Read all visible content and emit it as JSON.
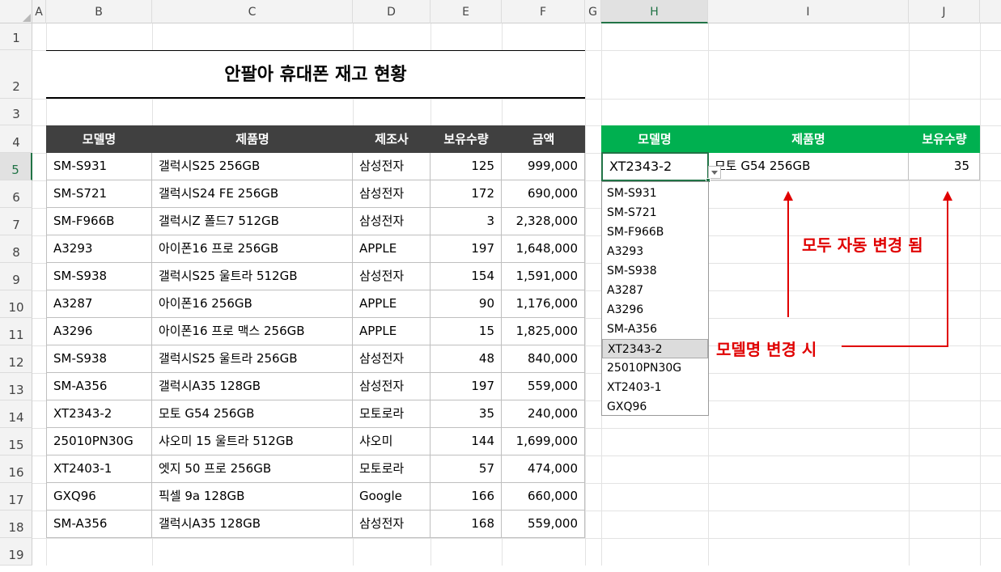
{
  "columns": [
    "A",
    "B",
    "C",
    "D",
    "E",
    "F",
    "G",
    "H",
    "I",
    "J"
  ],
  "rows": [
    "1",
    "2",
    "3",
    "4",
    "5",
    "6",
    "7",
    "8",
    "9",
    "10",
    "11",
    "12",
    "13",
    "14",
    "15",
    "16",
    "17",
    "18",
    "19"
  ],
  "title": "안팔아 휴대폰 재고 현황",
  "left_table": {
    "headers": [
      "모델명",
      "제품명",
      "제조사",
      "보유수량",
      "금액"
    ],
    "rows": [
      [
        "SM-S931",
        "갤럭시S25 256GB",
        "삼성전자",
        "125",
        "999,000"
      ],
      [
        "SM-S721",
        "갤럭시S24 FE 256GB",
        "삼성전자",
        "172",
        "690,000"
      ],
      [
        "SM-F966B",
        "갤럭시Z 폴드7 512GB",
        "삼성전자",
        "3",
        "2,328,000"
      ],
      [
        "A3293",
        "아이폰16 프로 256GB",
        "APPLE",
        "197",
        "1,648,000"
      ],
      [
        "SM-S938",
        "갤럭시S25 울트라 512GB",
        "삼성전자",
        "154",
        "1,591,000"
      ],
      [
        "A3287",
        "아이폰16 256GB",
        "APPLE",
        "90",
        "1,176,000"
      ],
      [
        "A3296",
        "아이폰16 프로 맥스 256GB",
        "APPLE",
        "15",
        "1,825,000"
      ],
      [
        "SM-S938",
        "갤럭시S25 울트라 256GB",
        "삼성전자",
        "48",
        "840,000"
      ],
      [
        "SM-A356",
        "갤럭시A35 128GB",
        "삼성전자",
        "197",
        "559,000"
      ],
      [
        "XT2343-2",
        "모토 G54 256GB",
        "모토로라",
        "35",
        "240,000"
      ],
      [
        "25010PN30G",
        "샤오미 15 울트라 512GB",
        "샤오미",
        "144",
        "1,699,000"
      ],
      [
        "XT2403-1",
        "엣지 50 프로 256GB",
        "모토로라",
        "57",
        "474,000"
      ],
      [
        "GXQ96",
        "픽셀 9a 128GB",
        "Google",
        "166",
        "660,000"
      ],
      [
        "SM-A356",
        "갤럭시A35 128GB",
        "삼성전자",
        "168",
        "559,000"
      ]
    ]
  },
  "right_table": {
    "headers": [
      "모델명",
      "제품명",
      "보유수량"
    ],
    "row": [
      "XT2343-2",
      "모토 G54 256GB",
      "35"
    ]
  },
  "dropdown": {
    "items": [
      "SM-S931",
      "SM-S721",
      "SM-F966B",
      "A3293",
      "SM-S938",
      "A3287",
      "A3296",
      "SM-A356",
      "XT2343-2",
      "25010PN30G",
      "XT2403-1",
      "GXQ96"
    ],
    "selected": "XT2343-2"
  },
  "annotations": {
    "auto_change": "모두 자동 변경 됨",
    "on_change": "모델명 변경 시"
  },
  "colors": {
    "annotation": "#e00000",
    "right_header": "#00b050",
    "left_header": "#404040",
    "selection": "#217346"
  }
}
